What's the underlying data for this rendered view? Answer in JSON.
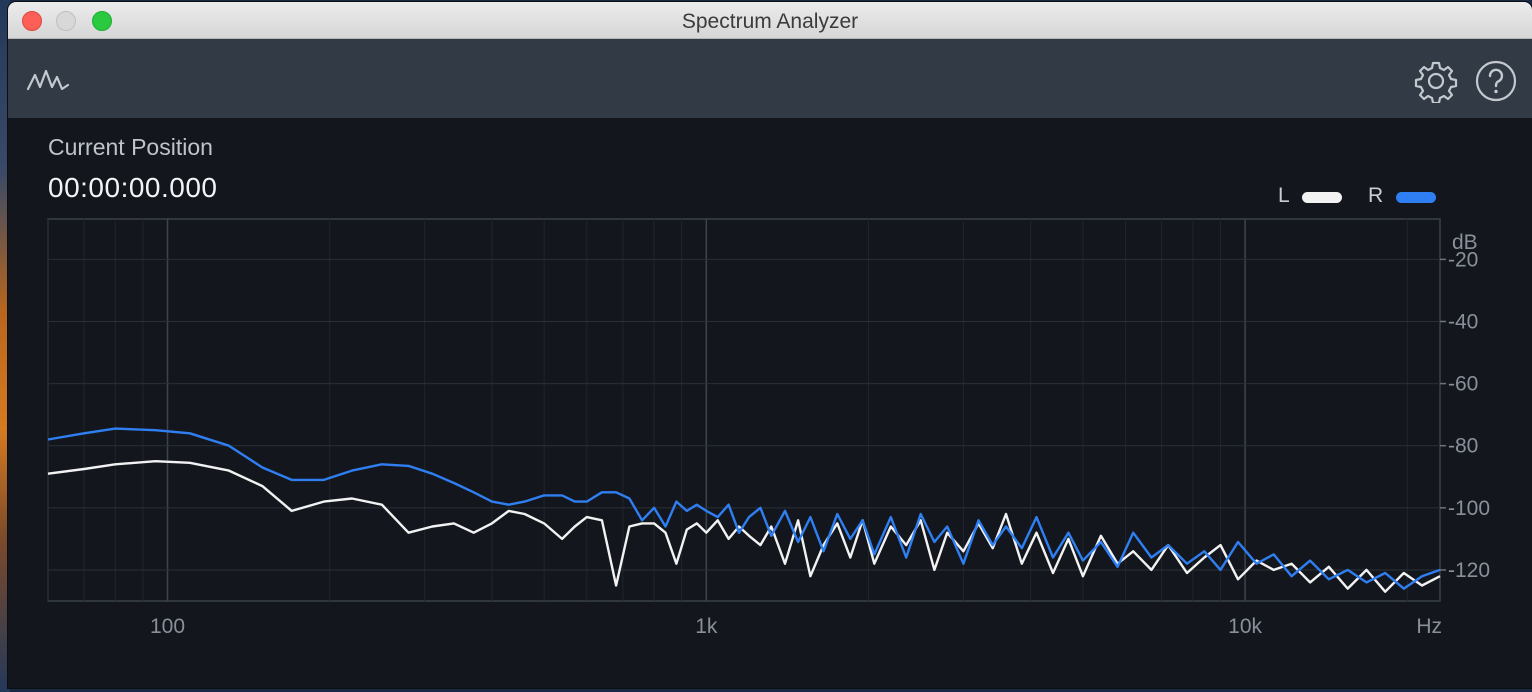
{
  "window": {
    "title": "Spectrum Analyzer",
    "controls": [
      "close",
      "minimize",
      "maximize"
    ]
  },
  "toolbar": {
    "left_icon": "spectrum-waveform-icon",
    "right_icons": [
      "gear-icon",
      "help-icon"
    ]
  },
  "position": {
    "label": "Current Position",
    "value": "00:00:00.000"
  },
  "legend": [
    {
      "label": "L",
      "color": "#f2f2f2"
    },
    {
      "label": "R",
      "color": "#2f7ff2"
    }
  ],
  "chart_data": {
    "type": "line",
    "x_scale": "log",
    "y_label": "dB",
    "x_label": "Hz",
    "x_ticks": [
      {
        "value": 100,
        "label": "100"
      },
      {
        "value": 1000,
        "label": "1k"
      },
      {
        "value": 10000,
        "label": "10k"
      }
    ],
    "y_ticks": [
      {
        "value": -20,
        "label": "-20"
      },
      {
        "value": -40,
        "label": "-40"
      },
      {
        "value": -60,
        "label": "-60"
      },
      {
        "value": -80,
        "label": "-80"
      },
      {
        "value": -100,
        "label": "-100"
      },
      {
        "value": -120,
        "label": "-120"
      }
    ],
    "xlim": [
      60,
      23000
    ],
    "ylim": [
      -130,
      -7
    ],
    "grid": true,
    "series": [
      {
        "name": "L",
        "color": "#f2f2f2",
        "points": [
          [
            60,
            -89
          ],
          [
            70,
            -87.5
          ],
          [
            80,
            -86
          ],
          [
            95,
            -85
          ],
          [
            110,
            -85.5
          ],
          [
            130,
            -88
          ],
          [
            150,
            -93
          ],
          [
            170,
            -101
          ],
          [
            195,
            -98
          ],
          [
            220,
            -97
          ],
          [
            250,
            -99
          ],
          [
            280,
            -108
          ],
          [
            310,
            -106
          ],
          [
            340,
            -105
          ],
          [
            370,
            -108
          ],
          [
            400,
            -105
          ],
          [
            430,
            -101
          ],
          [
            460,
            -102
          ],
          [
            500,
            -105
          ],
          [
            540,
            -110
          ],
          [
            570,
            -106
          ],
          [
            600,
            -103
          ],
          [
            640,
            -104
          ],
          [
            680,
            -125
          ],
          [
            720,
            -106
          ],
          [
            760,
            -105
          ],
          [
            800,
            -105
          ],
          [
            840,
            -108
          ],
          [
            880,
            -118
          ],
          [
            920,
            -107
          ],
          [
            960,
            -105
          ],
          [
            1000,
            -108
          ],
          [
            1050,
            -104
          ],
          [
            1100,
            -110
          ],
          [
            1150,
            -106
          ],
          [
            1200,
            -109
          ],
          [
            1260,
            -112
          ],
          [
            1320,
            -106
          ],
          [
            1400,
            -118
          ],
          [
            1480,
            -104
          ],
          [
            1560,
            -122
          ],
          [
            1650,
            -112
          ],
          [
            1750,
            -105
          ],
          [
            1850,
            -116
          ],
          [
            1950,
            -104
          ],
          [
            2050,
            -118
          ],
          [
            2200,
            -106
          ],
          [
            2350,
            -112
          ],
          [
            2500,
            -104
          ],
          [
            2650,
            -120
          ],
          [
            2800,
            -108
          ],
          [
            3000,
            -114
          ],
          [
            3200,
            -105
          ],
          [
            3400,
            -113
          ],
          [
            3600,
            -102
          ],
          [
            3850,
            -118
          ],
          [
            4100,
            -108
          ],
          [
            4400,
            -121
          ],
          [
            4700,
            -110
          ],
          [
            5000,
            -122
          ],
          [
            5400,
            -109
          ],
          [
            5800,
            -118
          ],
          [
            6200,
            -114
          ],
          [
            6700,
            -120
          ],
          [
            7200,
            -112
          ],
          [
            7800,
            -121
          ],
          [
            8400,
            -116
          ],
          [
            9000,
            -112
          ],
          [
            9700,
            -123
          ],
          [
            10500,
            -117
          ],
          [
            11300,
            -120
          ],
          [
            12200,
            -118
          ],
          [
            13200,
            -124
          ],
          [
            14300,
            -119
          ],
          [
            15500,
            -126
          ],
          [
            16800,
            -120
          ],
          [
            18200,
            -127
          ],
          [
            19700,
            -121
          ],
          [
            21300,
            -125
          ],
          [
            23000,
            -122
          ]
        ]
      },
      {
        "name": "R",
        "color": "#2f7ff2",
        "points": [
          [
            60,
            -78
          ],
          [
            70,
            -76
          ],
          [
            80,
            -74.5
          ],
          [
            95,
            -75
          ],
          [
            110,
            -76
          ],
          [
            130,
            -80
          ],
          [
            150,
            -87
          ],
          [
            170,
            -91
          ],
          [
            195,
            -91
          ],
          [
            220,
            -88
          ],
          [
            250,
            -86
          ],
          [
            280,
            -86.5
          ],
          [
            310,
            -89
          ],
          [
            340,
            -92
          ],
          [
            370,
            -95
          ],
          [
            400,
            -98
          ],
          [
            430,
            -99
          ],
          [
            460,
            -98
          ],
          [
            500,
            -96
          ],
          [
            540,
            -96
          ],
          [
            570,
            -98
          ],
          [
            600,
            -98
          ],
          [
            640,
            -95
          ],
          [
            680,
            -95
          ],
          [
            720,
            -97
          ],
          [
            760,
            -104
          ],
          [
            800,
            -100
          ],
          [
            840,
            -106
          ],
          [
            880,
            -98
          ],
          [
            920,
            -101
          ],
          [
            960,
            -99
          ],
          [
            1000,
            -101
          ],
          [
            1050,
            -103
          ],
          [
            1100,
            -99
          ],
          [
            1150,
            -108
          ],
          [
            1200,
            -103
          ],
          [
            1260,
            -100
          ],
          [
            1320,
            -109
          ],
          [
            1400,
            -101
          ],
          [
            1480,
            -111
          ],
          [
            1560,
            -103
          ],
          [
            1650,
            -114
          ],
          [
            1750,
            -102
          ],
          [
            1850,
            -110
          ],
          [
            1950,
            -104
          ],
          [
            2050,
            -115
          ],
          [
            2200,
            -103
          ],
          [
            2350,
            -116
          ],
          [
            2500,
            -102
          ],
          [
            2650,
            -111
          ],
          [
            2800,
            -106
          ],
          [
            3000,
            -118
          ],
          [
            3200,
            -104
          ],
          [
            3400,
            -112
          ],
          [
            3600,
            -106
          ],
          [
            3850,
            -113
          ],
          [
            4100,
            -103
          ],
          [
            4400,
            -116
          ],
          [
            4700,
            -108
          ],
          [
            5000,
            -117
          ],
          [
            5400,
            -111
          ],
          [
            5800,
            -119
          ],
          [
            6200,
            -108
          ],
          [
            6700,
            -116
          ],
          [
            7200,
            -112
          ],
          [
            7800,
            -118
          ],
          [
            8400,
            -114
          ],
          [
            9000,
            -120
          ],
          [
            9700,
            -111
          ],
          [
            10500,
            -118
          ],
          [
            11300,
            -115
          ],
          [
            12200,
            -122
          ],
          [
            13200,
            -117
          ],
          [
            14300,
            -123
          ],
          [
            15500,
            -120
          ],
          [
            16800,
            -124
          ],
          [
            18200,
            -121
          ],
          [
            19700,
            -126
          ],
          [
            21300,
            -122
          ],
          [
            23000,
            -120
          ]
        ]
      }
    ]
  }
}
